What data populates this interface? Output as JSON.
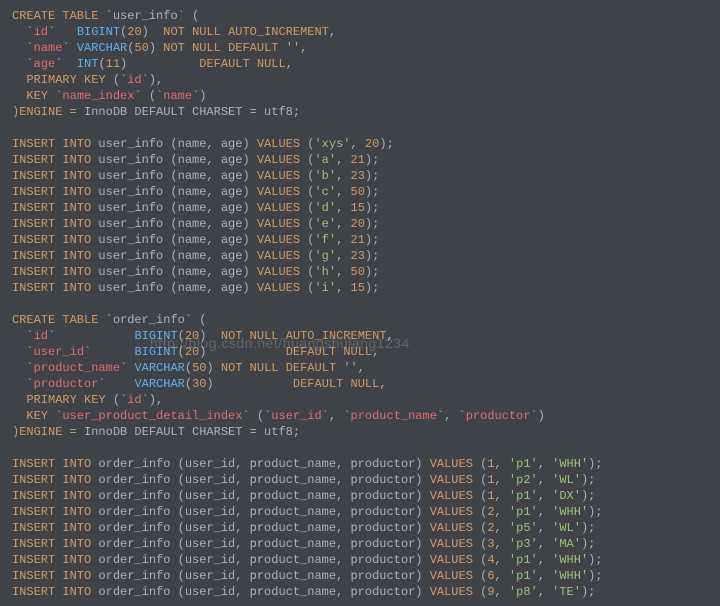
{
  "watermark": "http://blog.csdn.net/huangshulang1234",
  "user_table": {
    "name": "user_info",
    "cols": [
      {
        "name": "id",
        "type": "BIGINT",
        "size": 20,
        "flags": "NOT NULL AUTO_INCREMENT"
      },
      {
        "name": "name",
        "type": "VARCHAR",
        "size": 50,
        "flags": "NOT NULL DEFAULT ''"
      },
      {
        "name": "age",
        "type": "INT",
        "size": 11,
        "flags": "DEFAULT NULL"
      }
    ],
    "pkey": "id",
    "key_name": "name_index",
    "key_col": "name",
    "engine": "InnoDB DEFAULT CHARSET = utf8"
  },
  "user_rows": [
    {
      "name": "xys",
      "age": 20
    },
    {
      "name": "a",
      "age": 21
    },
    {
      "name": "b",
      "age": 23
    },
    {
      "name": "c",
      "age": 50
    },
    {
      "name": "d",
      "age": 15
    },
    {
      "name": "e",
      "age": 20
    },
    {
      "name": "f",
      "age": 21
    },
    {
      "name": "g",
      "age": 23
    },
    {
      "name": "h",
      "age": 50
    },
    {
      "name": "i",
      "age": 15
    }
  ],
  "order_table": {
    "name": "order_info",
    "cols": [
      {
        "name": "id",
        "type": "BIGINT",
        "size": 20,
        "flags": "NOT NULL AUTO_INCREMENT"
      },
      {
        "name": "user_id",
        "type": "BIGINT",
        "size": 20,
        "flags": "DEFAULT NULL"
      },
      {
        "name": "product_name",
        "type": "VARCHAR",
        "size": 50,
        "flags": "NOT NULL DEFAULT ''"
      },
      {
        "name": "productor",
        "type": "VARCHAR",
        "size": 30,
        "flags": "DEFAULT NULL"
      }
    ],
    "pkey": "id",
    "key_name": "user_product_detail_index",
    "key_cols": [
      "user_id",
      "product_name",
      "productor"
    ],
    "engine": "InnoDB DEFAULT CHARSET = utf8"
  },
  "order_rows": [
    {
      "uid": 1,
      "pn": "p1",
      "pr": "WHH"
    },
    {
      "uid": 1,
      "pn": "p2",
      "pr": "WL"
    },
    {
      "uid": 1,
      "pn": "p1",
      "pr": "DX"
    },
    {
      "uid": 2,
      "pn": "p1",
      "pr": "WHH"
    },
    {
      "uid": 2,
      "pn": "p5",
      "pr": "WL"
    },
    {
      "uid": 3,
      "pn": "p3",
      "pr": "MA"
    },
    {
      "uid": 4,
      "pn": "p1",
      "pr": "WHH"
    },
    {
      "uid": 6,
      "pn": "p1",
      "pr": "WHH"
    },
    {
      "uid": 9,
      "pn": "p8",
      "pr": "TE"
    }
  ],
  "t": {
    "create": "CREATE TABLE",
    "insert": "INSERT INTO",
    "values": "VALUES",
    "nn": "NOT NULL",
    "ai": "AUTO_INCREMENT",
    "def": "DEFAULT",
    "null": "NULL",
    "pk": "PRIMARY KEY",
    "key": "KEY",
    "eng": ")ENGINE =",
    "cols_user": "(name, age)",
    "cols_order": "(user_id, product_name, productor)"
  }
}
